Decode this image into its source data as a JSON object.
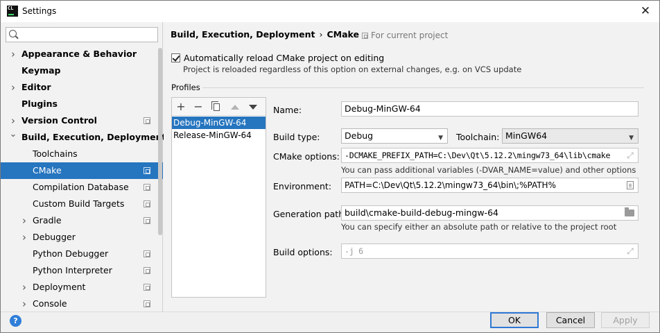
{
  "window": {
    "title": "Settings",
    "app_icon_text": "CL",
    "close_glyph": "✕"
  },
  "sidebar": {
    "search": {
      "placeholder": "",
      "value": ""
    },
    "items": [
      {
        "label": "Appearance & Behavior",
        "bold": true,
        "chevron": "right",
        "level": 0,
        "project": false
      },
      {
        "label": "Keymap",
        "bold": true,
        "chevron": "",
        "level": 0,
        "project": false
      },
      {
        "label": "Editor",
        "bold": true,
        "chevron": "right",
        "level": 0,
        "project": false
      },
      {
        "label": "Plugins",
        "bold": true,
        "chevron": "",
        "level": 0,
        "project": false
      },
      {
        "label": "Version Control",
        "bold": true,
        "chevron": "right",
        "level": 0,
        "project": true
      },
      {
        "label": "Build, Execution, Deployment",
        "bold": true,
        "chevron": "down",
        "level": 0,
        "project": false
      },
      {
        "label": "Toolchains",
        "bold": false,
        "chevron": "",
        "level": 1,
        "project": false
      },
      {
        "label": "CMake",
        "bold": false,
        "chevron": "",
        "level": 1,
        "project": true,
        "selected": true
      },
      {
        "label": "Compilation Database",
        "bold": false,
        "chevron": "",
        "level": 1,
        "project": true
      },
      {
        "label": "Custom Build Targets",
        "bold": false,
        "chevron": "",
        "level": 1,
        "project": true
      },
      {
        "label": "Gradle",
        "bold": false,
        "chevron": "right",
        "level": 1,
        "project": true
      },
      {
        "label": "Debugger",
        "bold": false,
        "chevron": "right",
        "level": 1,
        "project": false
      },
      {
        "label": "Python Debugger",
        "bold": false,
        "chevron": "",
        "level": 1,
        "project": true
      },
      {
        "label": "Python Interpreter",
        "bold": false,
        "chevron": "",
        "level": 1,
        "project": true
      },
      {
        "label": "Deployment",
        "bold": false,
        "chevron": "right",
        "level": 1,
        "project": true
      },
      {
        "label": "Console",
        "bold": false,
        "chevron": "right",
        "level": 1,
        "project": true
      }
    ]
  },
  "header": {
    "breadcrumb_parent": "Build, Execution, Deployment",
    "breadcrumb_sep": "›",
    "breadcrumb_current": "CMake",
    "scope": "For current project"
  },
  "reload": {
    "checked": true,
    "label": "Automatically reload CMake project on editing",
    "hint": "Project is reloaded regardless of this option on external changes, e.g. on VCS update"
  },
  "profiles": {
    "title": "Profiles",
    "toolbar": {
      "add": "+",
      "remove": "−"
    },
    "items": [
      "Debug-MinGW-64",
      "Release-MinGW-64"
    ],
    "selected_index": 0
  },
  "form": {
    "name_label": "Name:",
    "name_value": "Debug-MinGW-64",
    "build_type_label": "Build type:",
    "build_type_value": "Debug",
    "toolchain_label": "Toolchain:",
    "toolchain_value": "MinGW64",
    "cmake_options_label": "CMake options:",
    "cmake_options_value": "-DCMAKE_PREFIX_PATH=C:\\Dev\\Qt\\5.12.2\\mingw73_64\\lib\\cmake",
    "cmake_options_hint": "You can pass additional variables (-DVAR_NAME=value) and other options",
    "environment_label": "Environment:",
    "environment_value": "PATH=C:\\Dev\\Qt\\5.12.2\\mingw73_64\\bin\\;%PATH%",
    "generation_path_label": "Generation path:",
    "generation_path_value": "build\\cmake-build-debug-mingw-64",
    "generation_path_hint": "You can specify either an absolute path or relative to the project root",
    "build_options_label": "Build options:",
    "build_options_value": "-j 6",
    "combo_arrow": "▼",
    "expand_glyph": "⤢"
  },
  "footer": {
    "help": "?",
    "ok": "OK",
    "cancel": "Cancel",
    "apply": "Apply"
  }
}
